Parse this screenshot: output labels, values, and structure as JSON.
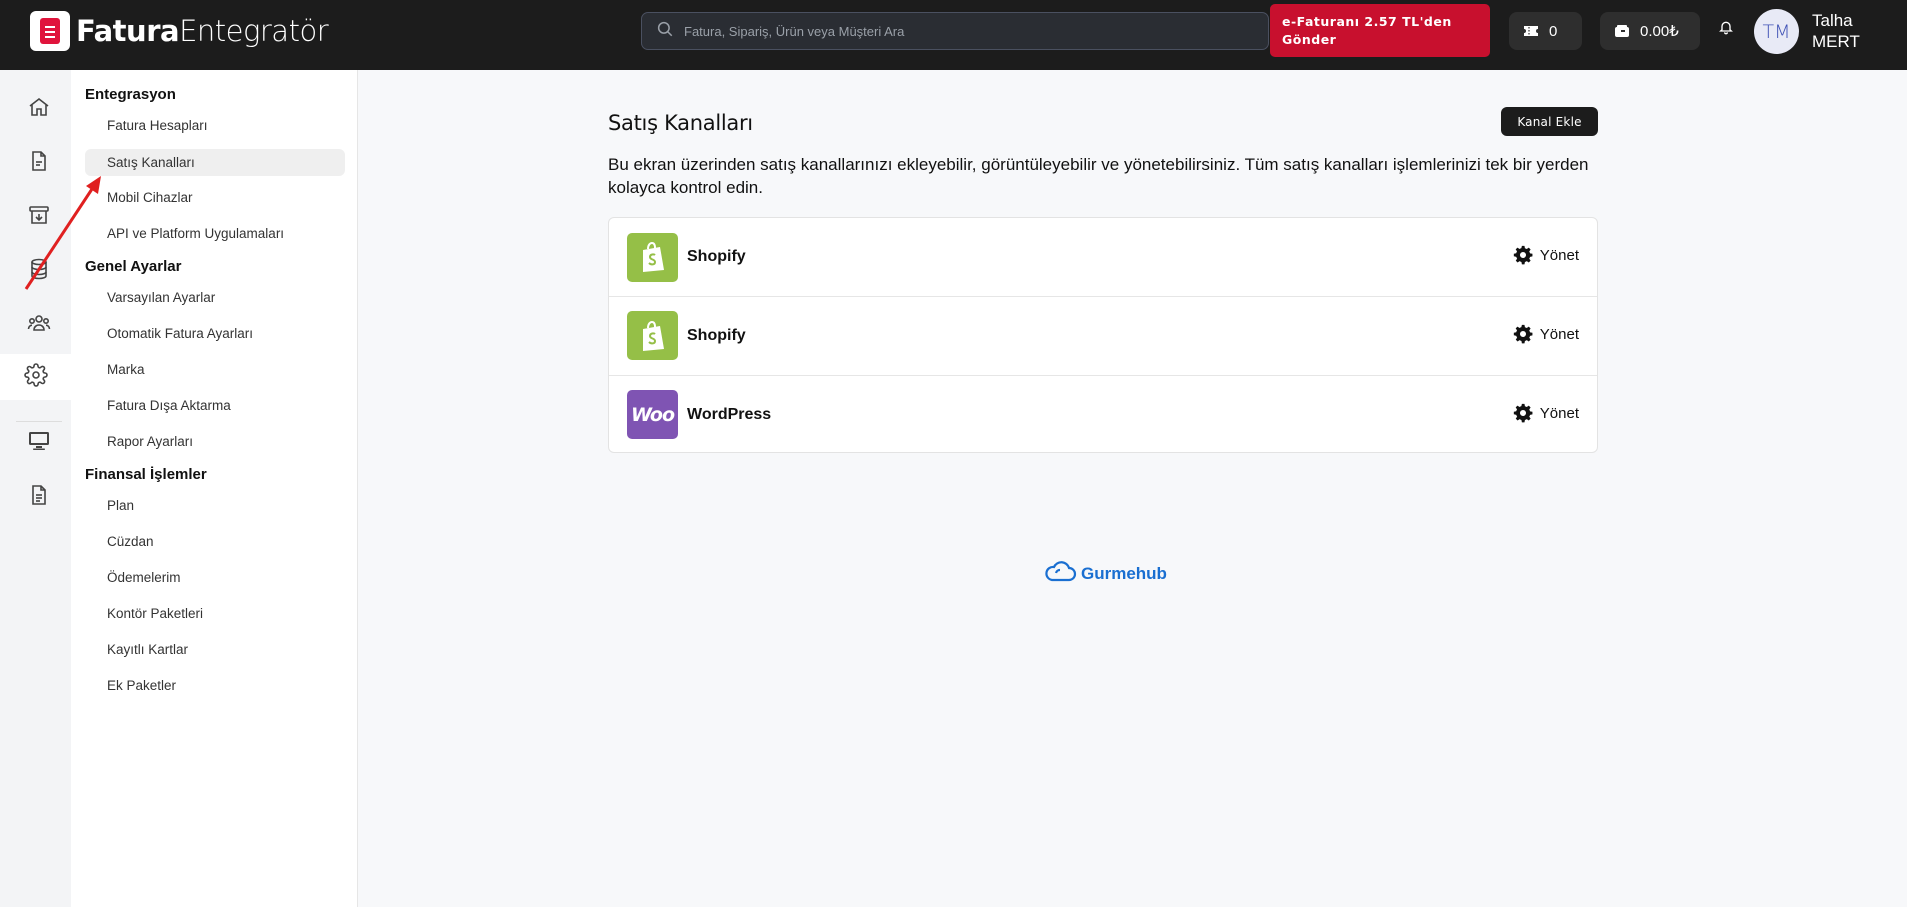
{
  "header": {
    "logo_bold": "Fatura",
    "logo_light": "Entegratör",
    "search_placeholder": "Fatura, Sipariş, Ürün veya Müşteri Ara",
    "promo_line1": "e-Faturanı 2.57 TL'den",
    "promo_line2": "Gönder",
    "credits": "0",
    "wallet": "0.00₺",
    "avatar_initials": "TM",
    "user_first": "Talha",
    "user_last": "MERT"
  },
  "rail": {
    "icons": [
      "home-icon",
      "document-icon",
      "archive-download-icon",
      "database-icon",
      "users-icon",
      "settings-icon",
      "monitor-icon",
      "file-text-icon"
    ],
    "active": "settings-icon"
  },
  "subnav": {
    "sections": [
      {
        "title": "Entegrasyon",
        "items": [
          "Fatura Hesapları",
          "Satış Kanalları",
          "Mobil Cihazlar",
          "API ve Platform Uygulamaları"
        ]
      },
      {
        "title": "Genel Ayarlar",
        "items": [
          "Varsayılan Ayarlar",
          "Otomatik Fatura Ayarları",
          "Marka",
          "Fatura Dışa Aktarma",
          "Rapor Ayarları"
        ]
      },
      {
        "title": "Finansal İşlemler",
        "items": [
          "Plan",
          "Cüzdan",
          "Ödemelerim",
          "Kontör Paketleri",
          "Kayıtlı Kartlar",
          "Ek Paketler"
        ]
      }
    ],
    "active_item": "Satış Kanalları"
  },
  "main": {
    "title": "Satış Kanalları",
    "add_button": "Kanal Ekle",
    "description": "Bu ekran üzerinden satış kanallarınızı ekleyebilir, görüntüleyebilir ve yönetebilirsiniz. Tüm satış kanalları işlemlerinizi tek bir yerden kolayca kontrol edin.",
    "channels": [
      {
        "name": "Shopify",
        "icon": "shopify-icon",
        "action": "Yönet"
      },
      {
        "name": "Shopify",
        "icon": "shopify-icon",
        "action": "Yönet"
      },
      {
        "name": "WordPress",
        "icon": "woocommerce-icon",
        "icon_text": "Woo",
        "action": "Yönet"
      }
    ]
  },
  "footer": {
    "brand": "Gurmehub"
  },
  "colors": {
    "topbar": "#1c1c1c",
    "promo": "#c8102e",
    "shopify": "#95bf47",
    "woo": "#7f54b3",
    "brand_link": "#1a6fd1",
    "annotation_arrow": "#e02020"
  }
}
